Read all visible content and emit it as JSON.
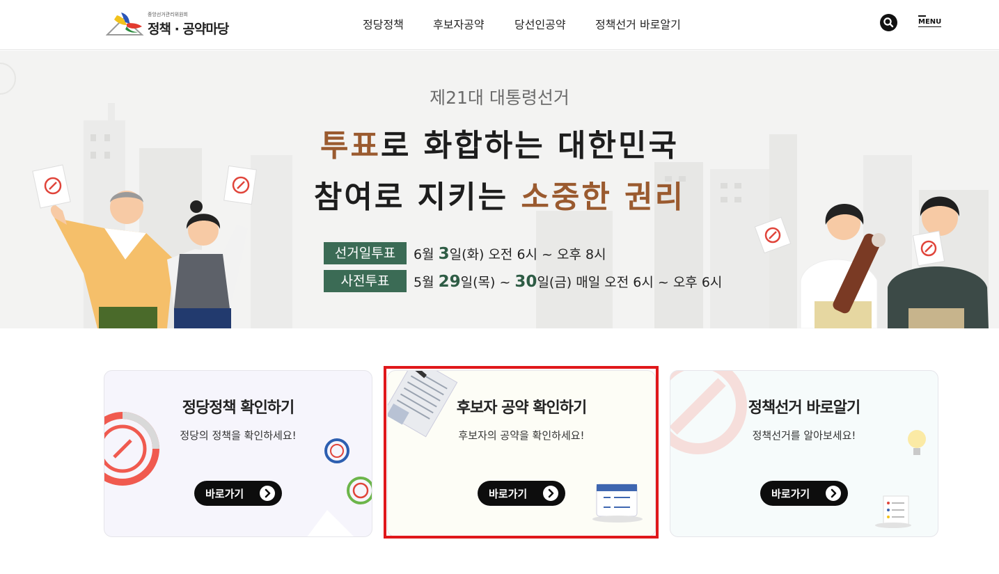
{
  "header": {
    "logo_org": "중앙선거관리위원회",
    "logo_title": "정책 · 공약마당",
    "nav": [
      "정당정책",
      "후보자공약",
      "당선인공약",
      "정책선거 바로알기"
    ],
    "search_icon": "search-icon",
    "menu_label": "MENU"
  },
  "hero": {
    "subtitle": "제21대 대통령선거",
    "line1_accent": "투표",
    "line1_rest": "로 화합하는 대한민국",
    "line2_start": "참여로 지키는 ",
    "line2_accent": "소중한 권리",
    "schedule": [
      {
        "tag": "선거일투표",
        "parts": [
          "6월 ",
          "3",
          "일(화) 오전 6시 ~ 오후 8시"
        ]
      },
      {
        "tag": "사전투표",
        "parts": [
          "5월 ",
          "29",
          "일(목) ~ ",
          "30",
          "일(금) 매일 오전 6시 ~ 오후 6시"
        ]
      }
    ]
  },
  "cards": [
    {
      "title": "정당정책 확인하기",
      "desc": "정당의 정책을 확인하세요!",
      "button": "바로가기"
    },
    {
      "title": "후보자 공약 확인하기",
      "desc": "후보자의 공약을 확인하세요!",
      "button": "바로가기"
    },
    {
      "title": "정책선거 바로알기",
      "desc": "정책선거를 알아보세요!",
      "button": "바로가기"
    }
  ],
  "colors": {
    "accent_green": "#3b6b55",
    "accent_brown": "#9a5a2f",
    "highlight_red": "#e0181b",
    "card1_bg": "#f6f5fc",
    "card2_bg": "#fdfdf6",
    "card3_bg": "#f6fbfb"
  }
}
